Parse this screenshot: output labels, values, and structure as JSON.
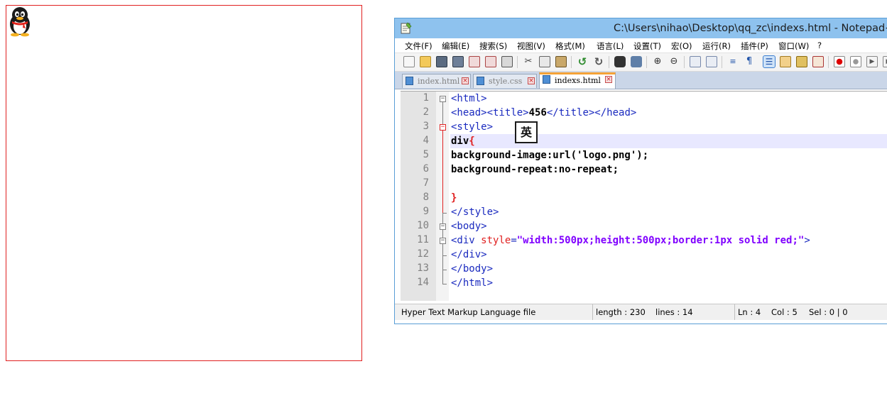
{
  "preview": {
    "logo_icon": "qq-penguin-icon"
  },
  "window": {
    "title": "C:\\Users\\nihao\\Desktop\\qq_zc\\indexs.html - Notepad++",
    "app_icon": "notepad-icon"
  },
  "menu": [
    "文件(F)",
    "编辑(E)",
    "搜索(S)",
    "视图(V)",
    "格式(M)",
    "语言(L)",
    "设置(T)",
    "宏(O)",
    "运行(R)",
    "插件(P)",
    "窗口(W)",
    "?"
  ],
  "tabs": [
    {
      "label": "index.html",
      "active": false
    },
    {
      "label": "style.css",
      "active": false
    },
    {
      "label": "indexs.html",
      "active": true
    }
  ],
  "editor": {
    "line_numbers": [
      "1",
      "2",
      "3",
      "4",
      "5",
      "6",
      "7",
      "8",
      "9",
      "10",
      "11",
      "12",
      "13",
      "14"
    ],
    "lines": {
      "l1_tag": "<html>",
      "l2_open": "<head><title>",
      "l2_text": "456",
      "l2_close": "</title></head>",
      "l3_tag": "<style>",
      "l4_sel": "div",
      "l4_brace": "{",
      "l5_text": "background-image:url('logo.png');",
      "l6_text": "background-repeat:no-repeat;",
      "l8_brace": "}",
      "l9_tag": "</style>",
      "l10_tag": "<body>",
      "l11_open": "<div ",
      "l11_attr": "style",
      "l11_eq": "=",
      "l11_val": "\"width:500px;height:500px;border:1px solid red;\"",
      "l11_close": ">",
      "l12_tag": "</div>",
      "l13_tag": "</body>",
      "l14_tag": "</html>"
    },
    "ime_indicator": "英"
  },
  "status": {
    "file_type": "Hyper Text Markup Language file",
    "length": "length : 230",
    "lines": "lines : 14",
    "ln": "Ln : 4",
    "col": "Col : 5",
    "sel": "Sel : 0 | 0"
  },
  "colors": {
    "preview_border": "#e02020",
    "title_bar": "#8ec2ee",
    "active_tab_accent": "#f5a236",
    "html_tag": "#1a2abf",
    "html_attr": "#e02020",
    "html_value": "#8000ff",
    "current_line": "#e8e8ff"
  }
}
